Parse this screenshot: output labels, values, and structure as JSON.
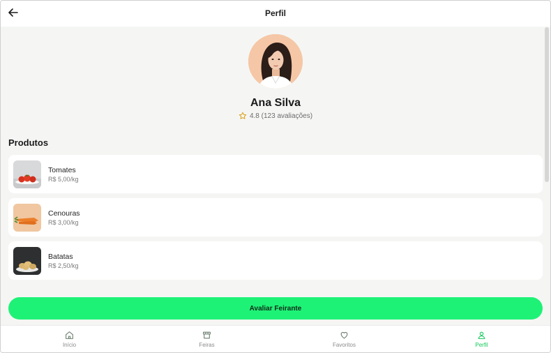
{
  "header": {
    "title": "Perfil",
    "back_icon": "arrow-left-icon"
  },
  "profile": {
    "name": "Ana Silva",
    "rating_text": "4.8 (123 avaliações)",
    "rating_value": 4.8,
    "rating_icon": "star-outline-icon"
  },
  "products": {
    "title": "Produtos",
    "items": [
      {
        "name": "Tomates",
        "price": "R$ 5,00/kg",
        "image": "tomatoes"
      },
      {
        "name": "Cenouras",
        "price": "R$ 3,00/kg",
        "image": "carrots"
      },
      {
        "name": "Batatas",
        "price": "R$ 2,50/kg",
        "image": "potatoes"
      }
    ]
  },
  "cta": {
    "label": "Avaliar Feirante"
  },
  "nav": {
    "items": [
      {
        "label": "Início",
        "icon": "home-icon"
      },
      {
        "label": "Feiras",
        "icon": "store-icon"
      },
      {
        "label": "Favoritos",
        "icon": "heart-icon"
      },
      {
        "label": "Perfil",
        "icon": "user-icon",
        "active": true
      }
    ]
  },
  "colors": {
    "accent": "#1ef276",
    "active_nav": "#12c85a",
    "background": "#f5f6f4",
    "star": "#d9a21b"
  }
}
